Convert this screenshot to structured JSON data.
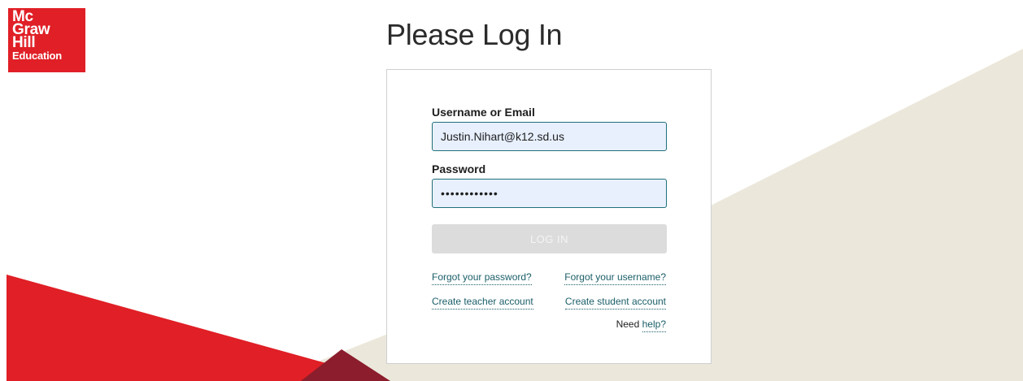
{
  "logo": {
    "line1": "Mc",
    "line2": "Graw",
    "line3": "Hill",
    "line4": "Education"
  },
  "page": {
    "title": "Please Log In"
  },
  "form": {
    "username_label": "Username or Email",
    "username_value": "Justin.Nihart@k12.sd.us",
    "password_label": "Password",
    "password_value": "passwordpass",
    "login_label": "LOG IN"
  },
  "links": {
    "forgot_password": "Forgot your password?",
    "forgot_username": "Forgot your username?",
    "create_teacher": "Create teacher account",
    "create_student": "Create student account",
    "need_text": "Need",
    "help": "help?"
  },
  "colors": {
    "brand_red": "#e01f26",
    "accent_teal": "#1f6f7a",
    "beige": "#ebe8db"
  }
}
